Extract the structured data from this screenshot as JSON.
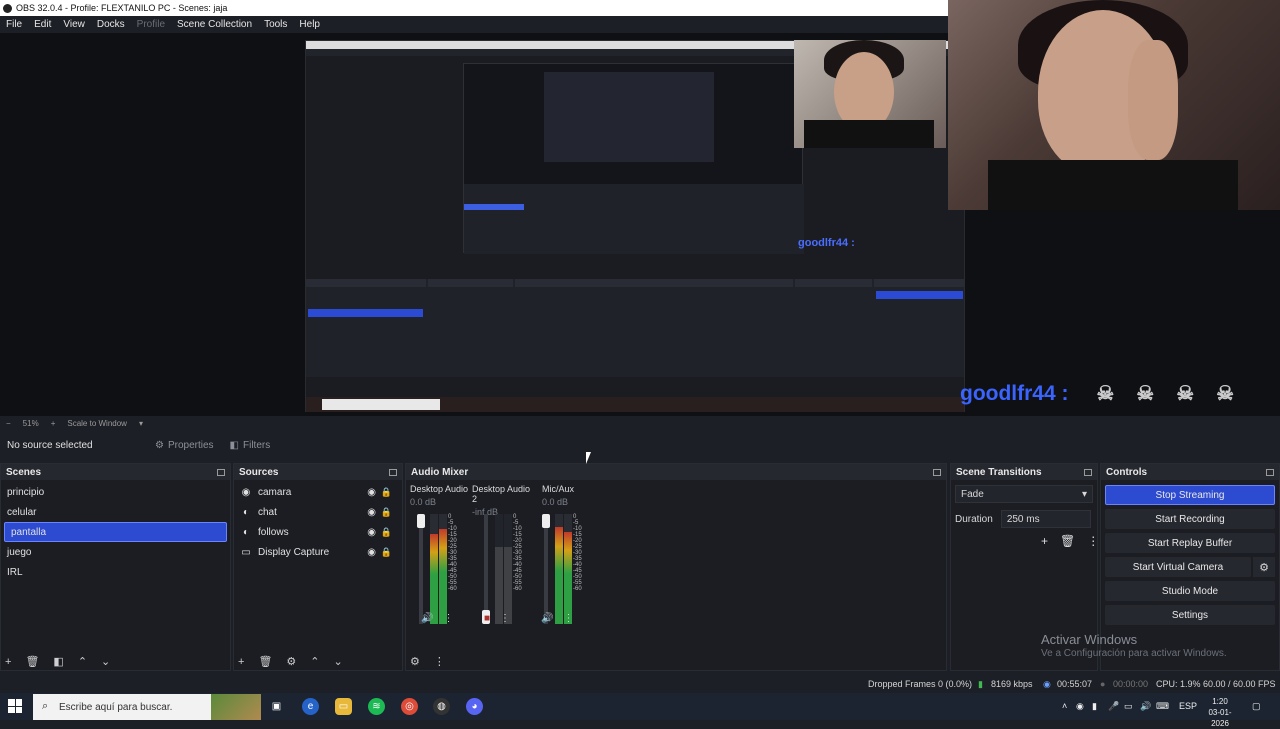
{
  "window": {
    "title": "OBS 32.0.4 - Profile: FLEXTANILO PC - Scenes: jaja"
  },
  "menu": [
    "File",
    "Edit",
    "View",
    "Docks",
    "Profile",
    "Scene Collection",
    "Tools",
    "Help"
  ],
  "preview": {
    "chat_user": "goodlfr44 :",
    "mini_chat": "goodlfr44 :",
    "skull_icon": "skull-icon"
  },
  "zoom": {
    "level": "51%",
    "mode": "Scale to Window"
  },
  "source_bar": {
    "no_source": "No source selected",
    "properties": "Properties",
    "filters": "Filters"
  },
  "scenes": {
    "title": "Scenes",
    "items": [
      "principio",
      "celular",
      "pantalla",
      "juego",
      "IRL"
    ],
    "selected": "pantalla"
  },
  "sources": {
    "title": "Sources",
    "items": [
      {
        "name": "camara",
        "icon": "camera-icon"
      },
      {
        "name": "chat",
        "icon": "browser-icon"
      },
      {
        "name": "follows",
        "icon": "browser-icon"
      },
      {
        "name": "Display Capture",
        "icon": "monitor-icon"
      }
    ]
  },
  "mixer": {
    "title": "Audio Mixer",
    "channels": [
      {
        "name": "Desktop Audio",
        "db": "0.0 dB",
        "muted": false
      },
      {
        "name": "Desktop Audio 2",
        "db": "-inf dB",
        "muted": true
      },
      {
        "name": "Mic/Aux",
        "db": "0.0 dB",
        "muted": false
      }
    ],
    "scale": [
      "0",
      "-5",
      "-10",
      "-15",
      "-20",
      "-25",
      "-30",
      "-35",
      "-40",
      "-45",
      "-50",
      "-55",
      "-60"
    ]
  },
  "transitions": {
    "title": "Scene Transitions",
    "selected": "Fade",
    "duration_label": "Duration",
    "duration_value": "250 ms"
  },
  "controls": {
    "title": "Controls",
    "stop_streaming": "Stop Streaming",
    "start_recording": "Start Recording",
    "start_replay": "Start Replay Buffer",
    "start_virtual": "Start Virtual Camera",
    "studio_mode": "Studio Mode",
    "settings": "Settings"
  },
  "activate": {
    "title": "Activar Windows",
    "subtitle": "Ve a Configuración para activar Windows."
  },
  "status": {
    "dropped": "Dropped Frames 0 (0.0%)",
    "bitrate": "8169 kbps",
    "stream_time": "00:55:07",
    "rec_time": "00:00:00",
    "cpu": "CPU: 1.9%",
    "fps": "60.00 / 60.00 FPS"
  },
  "taskbar": {
    "search_placeholder": "Escribe aquí para buscar.",
    "lang": "ESP",
    "time": "1:20",
    "date": "03-01-2026"
  }
}
